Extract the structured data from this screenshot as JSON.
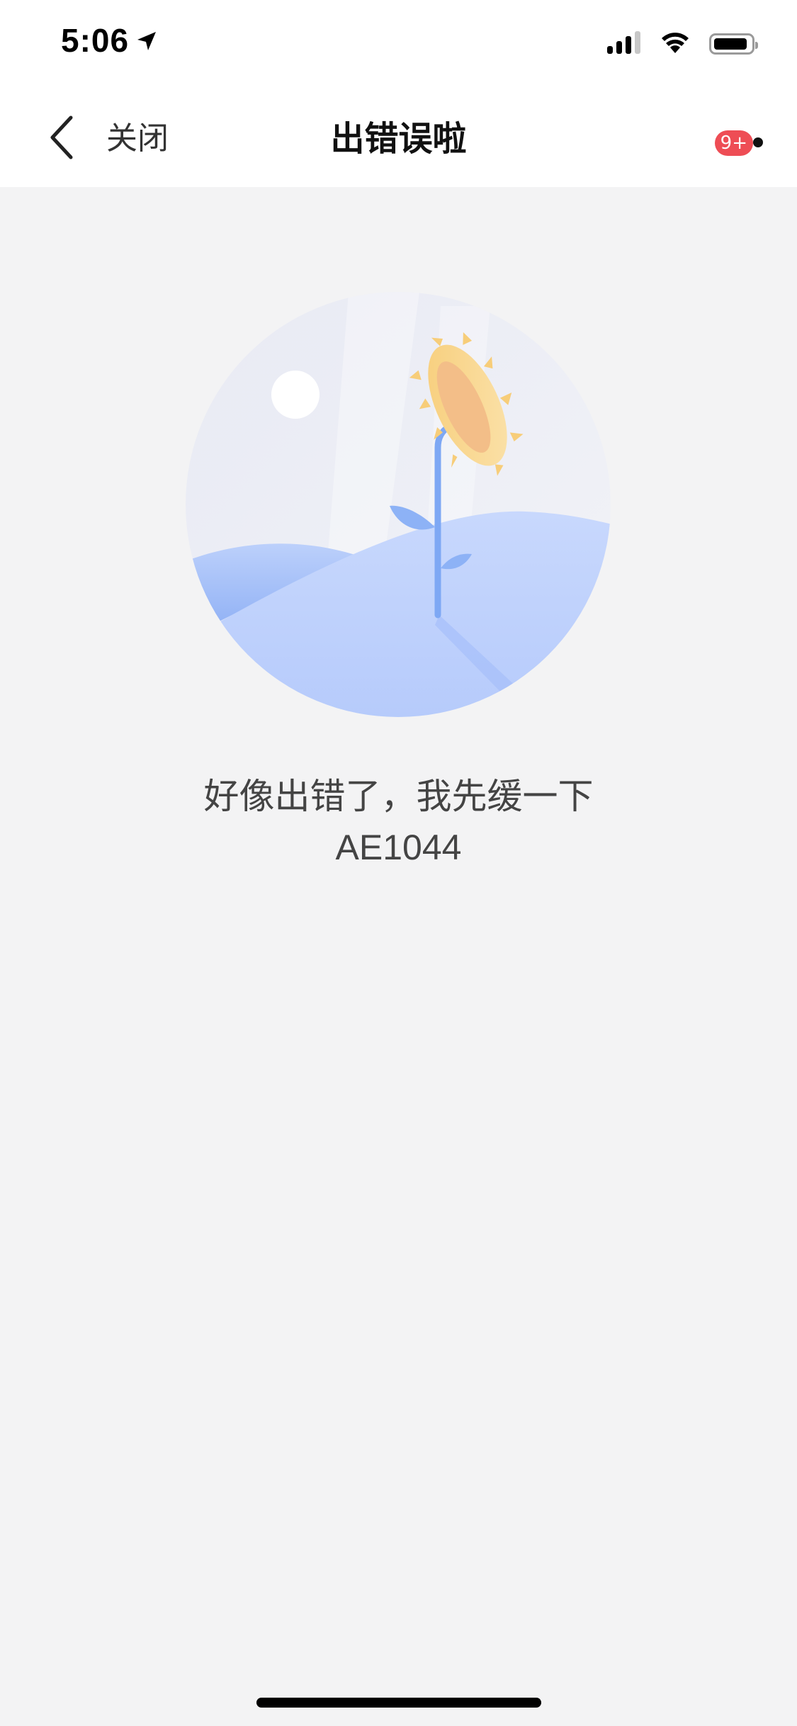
{
  "status_bar": {
    "time": "5:06",
    "icons": [
      "location-arrow-icon",
      "cellular-signal-icon",
      "wifi-icon",
      "battery-icon"
    ]
  },
  "navbar": {
    "back_icon": "chevron-left-icon",
    "close_label": "关闭",
    "title": "出错误啦",
    "more_icon": "more-dots-icon",
    "badge": "9+"
  },
  "content": {
    "illustration": "sunflower-hill-illustration",
    "message": "好像出错了，我先缓一下",
    "error_code": "AE1044"
  },
  "colors": {
    "background": "#f3f3f4",
    "navbar": "#ffffff",
    "badge": "#ee4d55",
    "text": "#444444"
  }
}
